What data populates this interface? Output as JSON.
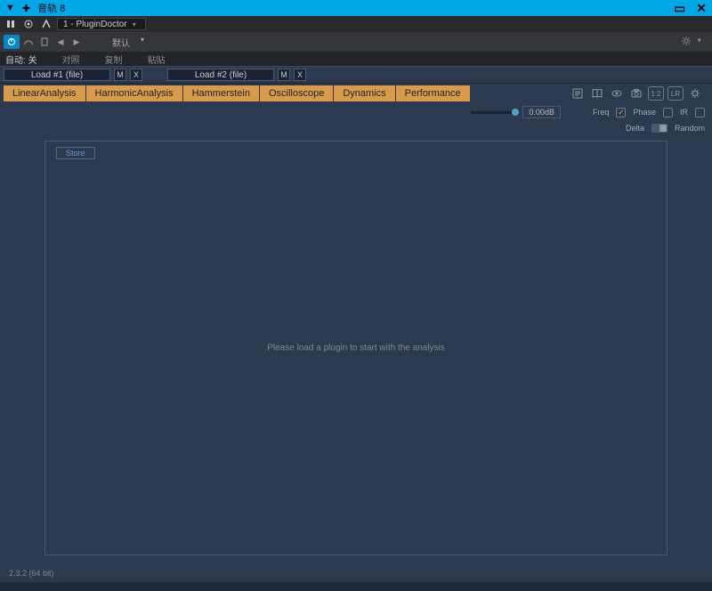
{
  "titlebar": {
    "track": "音轨 8"
  },
  "window": {
    "title": "1 - PluginDoctor"
  },
  "toolbar2": {
    "preset": "默认"
  },
  "menubar": {
    "auto": "自动: 关",
    "compare": "对照",
    "copy": "复制",
    "paste": "粘贴"
  },
  "loadbar": {
    "load1": "Load #1 (file)",
    "load2": "Load #2 (file)",
    "m": "M",
    "x": "X"
  },
  "tabs": {
    "linear": "LinearAnalysis",
    "harmonic": "HarmonicAnalysis",
    "hammerstein": "Hammerstein",
    "oscilloscope": "Oscilloscope",
    "dynamics": "Dynamics",
    "performance": "Performance"
  },
  "toolicons": {
    "ratio": "1:2",
    "lr": "LR"
  },
  "controls": {
    "db": "0.00dB",
    "freq": "Freq",
    "phase": "Phase",
    "ir": "IR",
    "delta": "Delta",
    "random": "Random"
  },
  "canvas": {
    "store": "Store",
    "placeholder": "Please load a plugin to start with the analysis"
  },
  "status": {
    "version": "2.3.2 (64 bit)"
  }
}
